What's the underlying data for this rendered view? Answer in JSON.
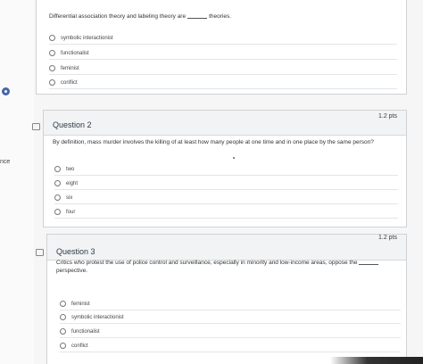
{
  "left": {
    "cut_label": "nce"
  },
  "question1": {
    "text_before": "Differential association theory and labeling theory are",
    "text_after": "theories.",
    "options": [
      "symbolic interactionist",
      "functionalist",
      "feminist",
      "conflict"
    ]
  },
  "question2": {
    "title": "Question 2",
    "points": "1.2 pts",
    "text": "By definition, mass murder involves the killing of at least how many people at one time and in one place by the same person?",
    "options": [
      "two",
      "eight",
      "six",
      "four"
    ]
  },
  "question3": {
    "title": "Question 3",
    "points": "1.2 pts",
    "text": "Critics who protest the use of police control and surveillance, especially in minority and low-income areas, oppose the",
    "text_after": "perspective.",
    "options": [
      "feminist",
      "symbolic interactionist",
      "functionalist",
      "conflict"
    ]
  },
  "colors": {
    "accent": "#4666a8",
    "card_header": "#f2f3f4",
    "border": "#cfd3d6"
  }
}
